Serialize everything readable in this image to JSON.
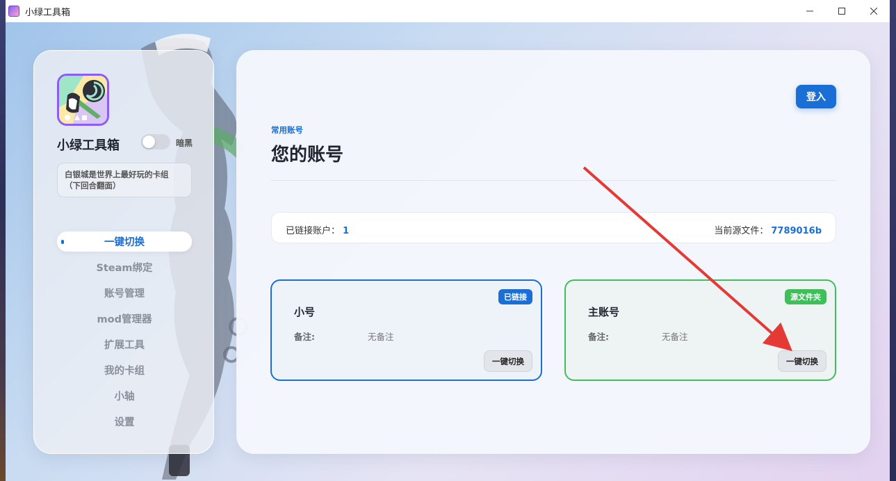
{
  "window": {
    "title": "小绿工具箱",
    "controls": [
      "minimize",
      "maximize",
      "close"
    ]
  },
  "sidebar": {
    "app_name": "小绿工具箱",
    "dark_toggle_label": "暗黑",
    "dark_mode_on": false,
    "motto": "白银城是世界上最好玩的卡组（下回合翻面）",
    "nav": [
      {
        "label": "一键切换",
        "active": true
      },
      {
        "label": "Steam绑定",
        "active": false
      },
      {
        "label": "账号管理",
        "active": false
      },
      {
        "label": "mod管理器",
        "active": false
      },
      {
        "label": "扩展工具",
        "active": false
      },
      {
        "label": "我的卡组",
        "active": false
      },
      {
        "label": "小轴",
        "active": false
      },
      {
        "label": "设置",
        "active": false
      }
    ]
  },
  "main": {
    "login_label": "登入",
    "kicker": "常用账号",
    "title": "您的账号",
    "stats": {
      "linked_label": "已链接账户：",
      "linked_count": "1",
      "source_label": "当前源文件：",
      "source_value": "7789016b"
    },
    "cards": [
      {
        "name": "小号",
        "badge": "已链接",
        "note_label": "备注:",
        "note_value": "无备注",
        "button": "一键切换"
      },
      {
        "name": "主账号",
        "badge": "源文件夹",
        "note_label": "备注:",
        "note_value": "无备注",
        "button": "一键切换"
      }
    ]
  },
  "colors": {
    "accent": "#1a6fd6",
    "source_green": "#3fbf5a",
    "annotation_arrow": "#e53935"
  }
}
